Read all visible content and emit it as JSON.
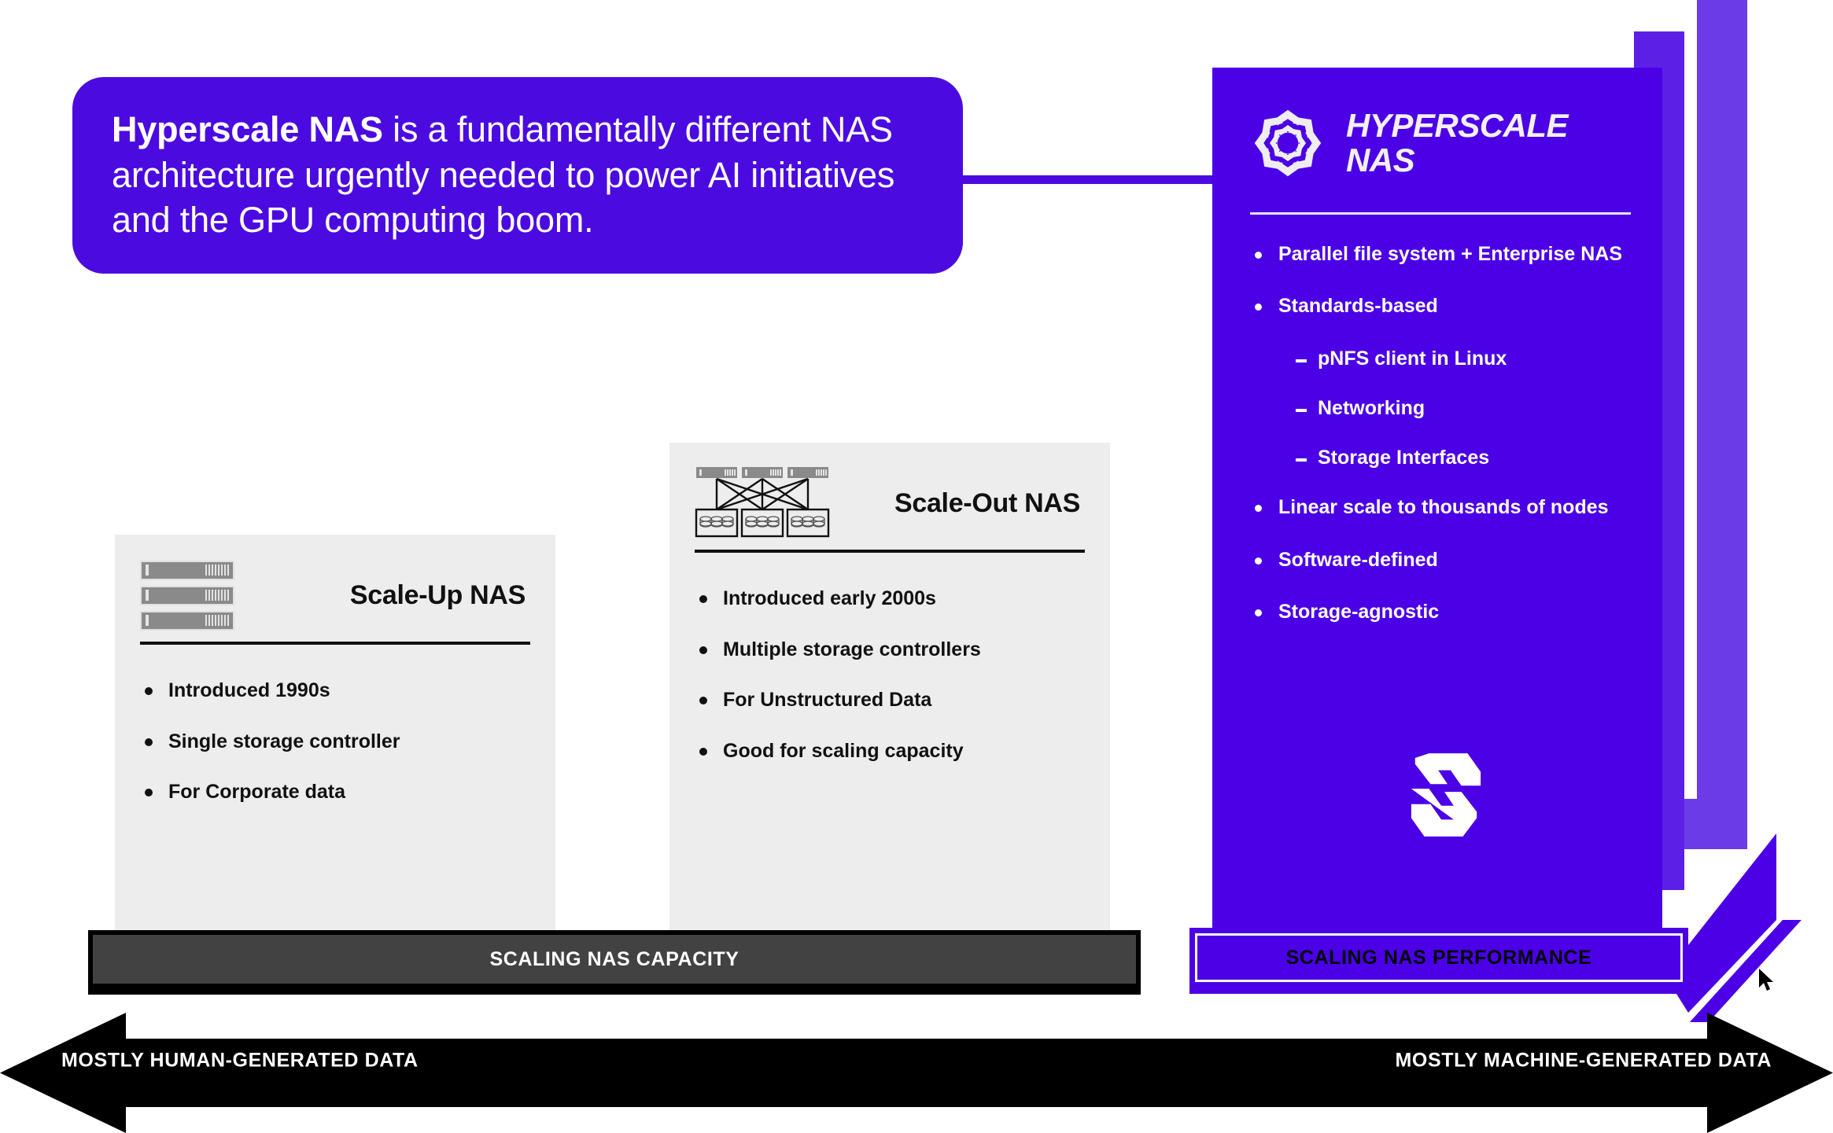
{
  "callout": {
    "lead": "Hyperscale NAS",
    "rest": " is a fundamentally different NAS architecture urgently needed to power AI initiatives and the GPU computing boom."
  },
  "hyperscale_panel": {
    "logo_icon": "hyperscale-mandala-icon",
    "title_line1": "HYPERSCALE",
    "title_line2": "NAS",
    "brand_icon": "hammerspace-logo-icon",
    "bullets": [
      {
        "text": "Parallel file system + Enterprise NAS",
        "level": 1
      },
      {
        "text": "Standards-based",
        "level": 1
      },
      {
        "text": "pNFS client in Linux",
        "level": 2
      },
      {
        "text": "Networking",
        "level": 2
      },
      {
        "text": "Storage Interfaces",
        "level": 2
      },
      {
        "text": "Linear scale to thousands of nodes",
        "level": 1
      },
      {
        "text": "Software-defined",
        "level": 1
      },
      {
        "text": "Storage-agnostic",
        "level": 1
      }
    ]
  },
  "scale_up_card": {
    "icon": "server-rack-icon",
    "title": "Scale-Up NAS",
    "bullets": [
      "Introduced 1990s",
      "Single storage controller",
      "For Corporate data"
    ]
  },
  "scale_out_card": {
    "icon": "clustered-storage-icon",
    "title": "Scale-Out NAS",
    "bullets": [
      "Introduced early 2000s",
      "Multiple storage controllers",
      "For Unstructured Data",
      "Good for scaling capacity"
    ]
  },
  "footer_bars": {
    "capacity_label": "SCALING NAS CAPACITY",
    "performance_label": "SCALING NAS PERFORMANCE"
  },
  "axis": {
    "left_label": "MOSTLY HUMAN-GENERATED DATA",
    "right_label": "MOSTLY MACHINE-GENERATED DATA",
    "arrow_icon": "double-headed-arrow-icon"
  },
  "colors": {
    "brand_purple": "#4B00E6",
    "purple_mid": "#5C1FE6",
    "purple_light": "#6B3BE8",
    "callout_purple": "#4B0BE0",
    "card_grey": "#EDEDED",
    "capacity_bar_grey": "#424242",
    "black": "#000000",
    "white": "#FFFFFF"
  },
  "cursor": {
    "icon": "mouse-pointer-icon"
  }
}
